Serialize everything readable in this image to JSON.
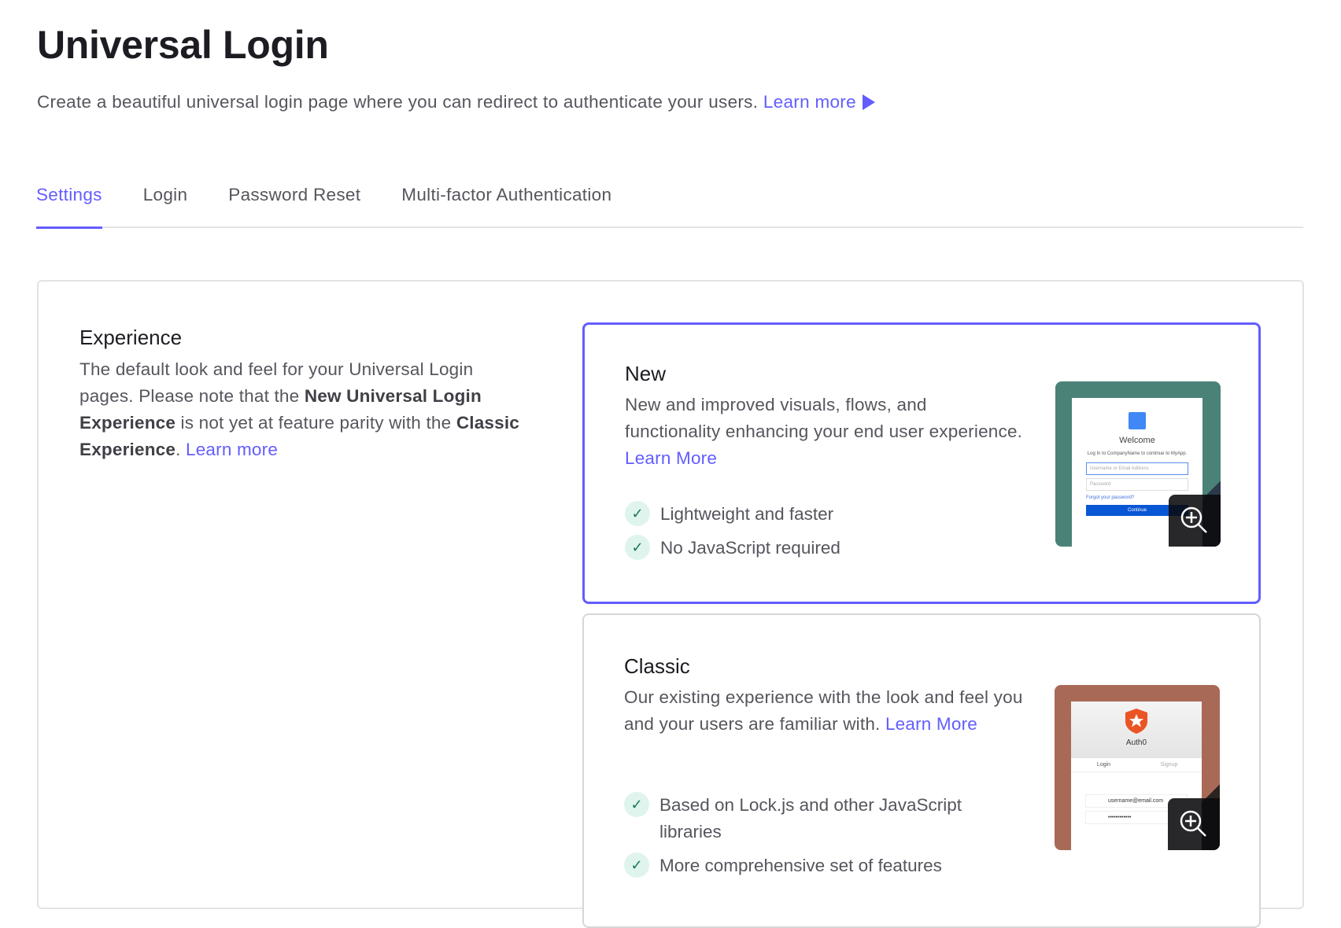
{
  "page": {
    "title": "Universal Login",
    "subtitle": "Create a beautiful universal login page where you can redirect to authenticate your users.",
    "learn_more": "Learn more"
  },
  "tabs": [
    {
      "label": "Settings"
    },
    {
      "label": "Login"
    },
    {
      "label": "Password Reset"
    },
    {
      "label": "Multi-factor Authentication"
    }
  ],
  "experience": {
    "title": "Experience",
    "desc_1": "The default look and feel for your Universal Login pages. Please note that the ",
    "bold_1": "New Universal Login Experience",
    "desc_2": " is not yet at feature parity with the ",
    "bold_2": "Classic Experience",
    "desc_3": ". ",
    "learn_more": "Learn more"
  },
  "options": {
    "new": {
      "title": "New",
      "desc": "New and improved visuals, flows, and functionality enhancing your end user experience.",
      "learn_more": "Learn More",
      "features": [
        "Lightweight and faster",
        "No JavaScript required"
      ],
      "preview": {
        "welcome": "Welcome",
        "login_to": "Log In to CompanyName to continue to MyApp.",
        "username": "Username or Email Address",
        "password": "Password",
        "forgot": "Forgot your password?",
        "continue": "Continue"
      }
    },
    "classic": {
      "title": "Classic",
      "desc": "Our existing experience with the look and feel you and your users are familiar with.",
      "learn_more": "Learn More",
      "features": [
        "Based on Lock.js and other JavaScript libraries",
        "More comprehensive set of features"
      ],
      "preview": {
        "brand": "Auth0",
        "tab_login": "Login",
        "tab_signup": "Signup",
        "email": "username@email.com",
        "password": "••••••••••••"
      }
    }
  },
  "colors": {
    "accent": "#635dff",
    "new_bg": "#4a8278",
    "classic_bg": "#a86a57"
  }
}
